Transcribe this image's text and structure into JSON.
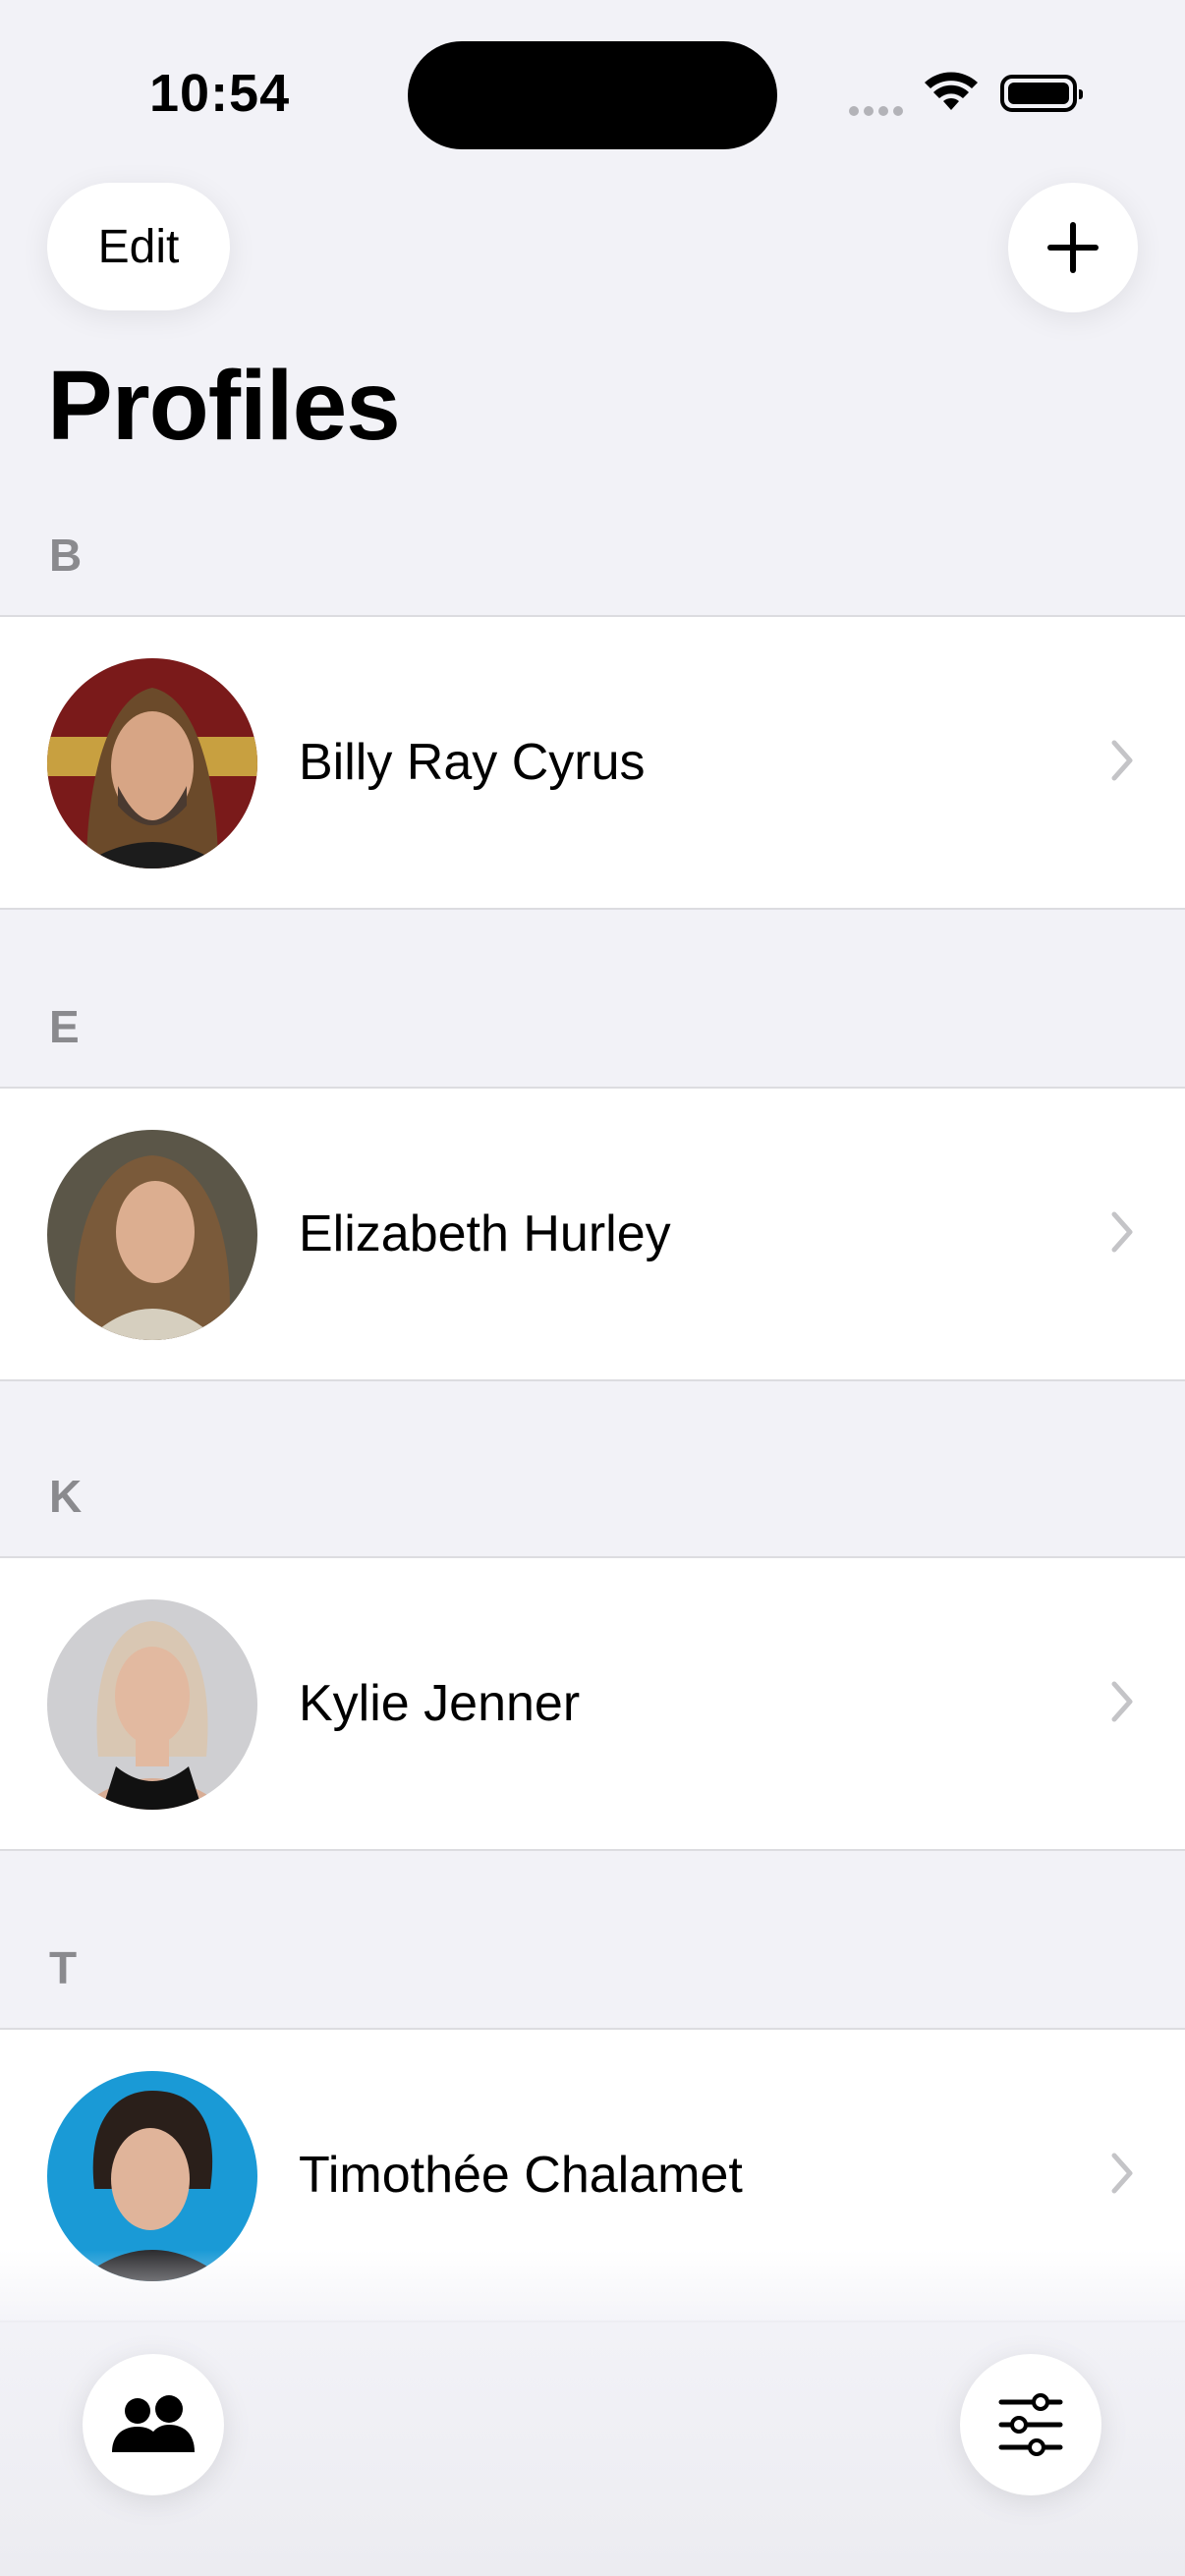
{
  "status_bar": {
    "time": "10:54",
    "icons": [
      "cellular-icon",
      "wifi-icon",
      "battery-icon"
    ]
  },
  "nav": {
    "edit_label": "Edit",
    "add_icon": "plus-icon"
  },
  "page": {
    "title": "Profiles"
  },
  "sections": [
    {
      "letter": "B",
      "profile": {
        "name": "Billy Ray Cyrus"
      }
    },
    {
      "letter": "E",
      "profile": {
        "name": "Elizabeth Hurley"
      }
    },
    {
      "letter": "K",
      "profile": {
        "name": "Kylie Jenner"
      }
    },
    {
      "letter": "T",
      "profile": {
        "name": "Timothée Chalamet"
      }
    }
  ],
  "toolbar": {
    "left_icon": "people-icon",
    "right_icon": "sliders-icon"
  }
}
